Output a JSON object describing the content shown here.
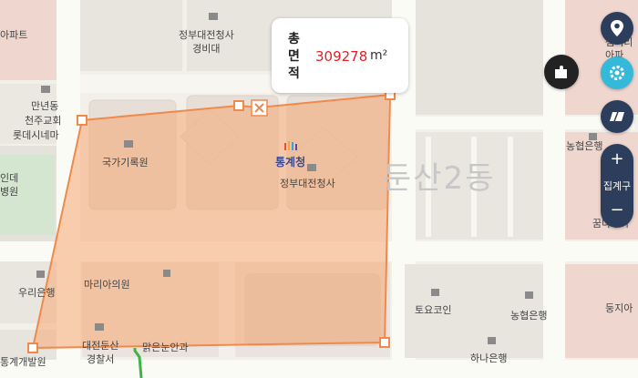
{
  "map": {
    "area_popup": {
      "label": "총면적",
      "value": "309278",
      "unit": "m²"
    },
    "labels": {
      "gov_complex_guard": "정부대전청사\n경비대",
      "apartment_left": "아파트",
      "mannyeon_dong": "만년동",
      "cheonju_church": "천주교회",
      "lotte_cinema": "롯데시네마",
      "hospital_left": "인데\n병원",
      "national_archives": "국가기록원",
      "statistics_korea": "통계청",
      "gov_complex": "정부대전청사",
      "dunsan2": "둔산2동",
      "nonghyup_top": "농협은행",
      "kkum_apt": "꿈나무아",
      "woori_bank": "우리은행",
      "maria_clinic": "마리아의원",
      "toyo_coin": "토요코인",
      "nonghyup_bottom": "농협은행",
      "daejeon_police": "대전둔산\n경찰서",
      "malgeun_eye": "맑은눈안과",
      "hana_bank": "하나은행",
      "dongji_apt": "둥지아",
      "stat_dev": "통계개발원",
      "top_right_apt": "샘머리\n아파"
    },
    "zoom_label": "집계구",
    "icons": [
      "location-pin-icon",
      "settings-gear-icon",
      "layer-toggle-icon",
      "puzzle-icon",
      "zoom-in-icon",
      "zoom-out-icon",
      "close-icon"
    ],
    "colors": {
      "polygon_fill": "#f5a772",
      "polygon_stroke": "#ef8a4c",
      "popup_value": "#e41f25",
      "control_dark": "#2d3e5c",
      "control_cyan": "#35b9da"
    }
  }
}
